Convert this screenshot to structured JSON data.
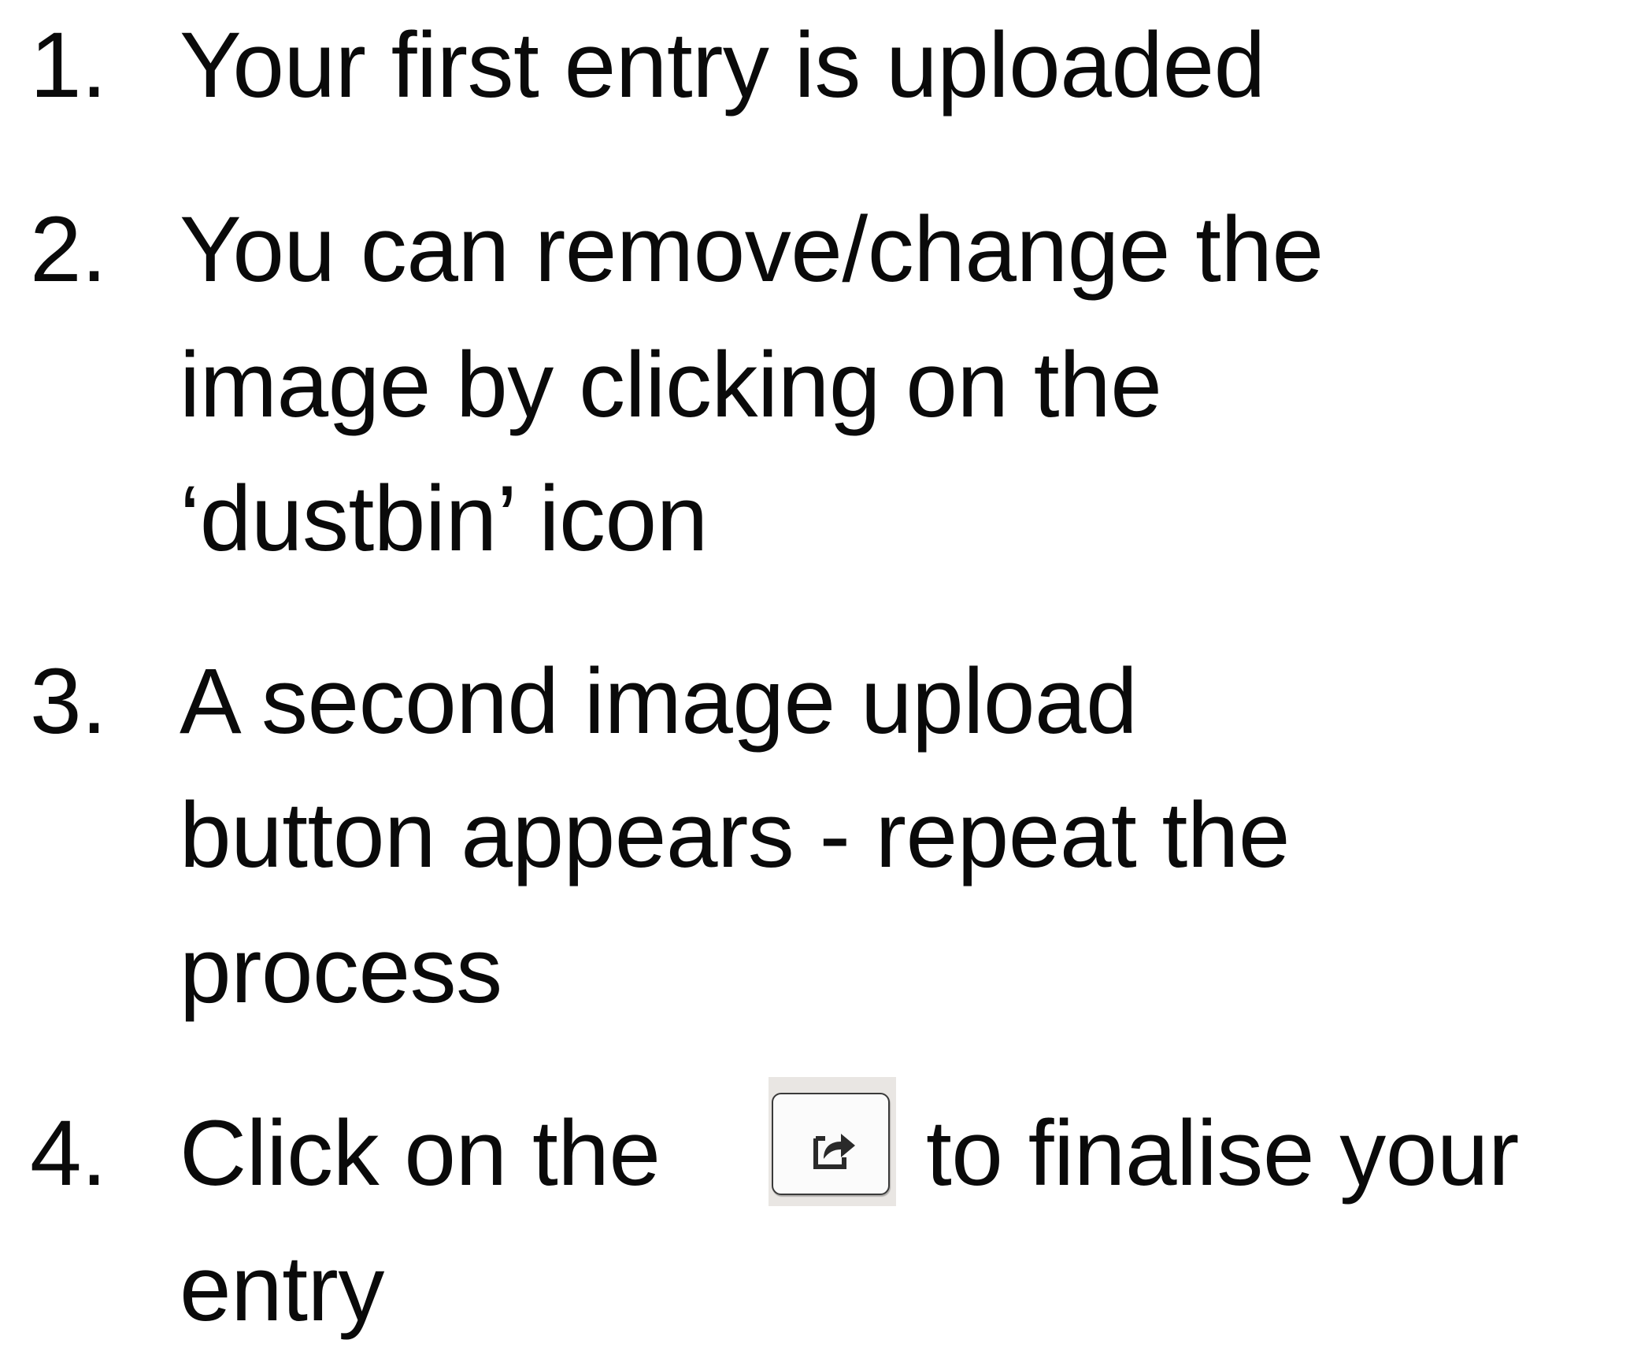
{
  "steps": [
    {
      "number": "1.",
      "lines": [
        "Your first entry is uploaded"
      ]
    },
    {
      "number": "2.",
      "lines": [
        "You can remove/change the",
        "image by clicking on the",
        "‘dustbin’ icon"
      ]
    },
    {
      "number": "3.",
      "lines": [
        "A second image upload",
        "button appears - repeat the",
        "process"
      ]
    },
    {
      "number": "4.",
      "lines": [
        "Click on the",
        "to finalise your",
        "entry"
      ]
    }
  ],
  "icons": {
    "share_button_icon": "share-arrow-icon"
  },
  "colors": {
    "text": "#0a0a0a",
    "background": "#ffffff",
    "button_face": "#fbfbfb",
    "button_border": "#3a3a3a"
  }
}
